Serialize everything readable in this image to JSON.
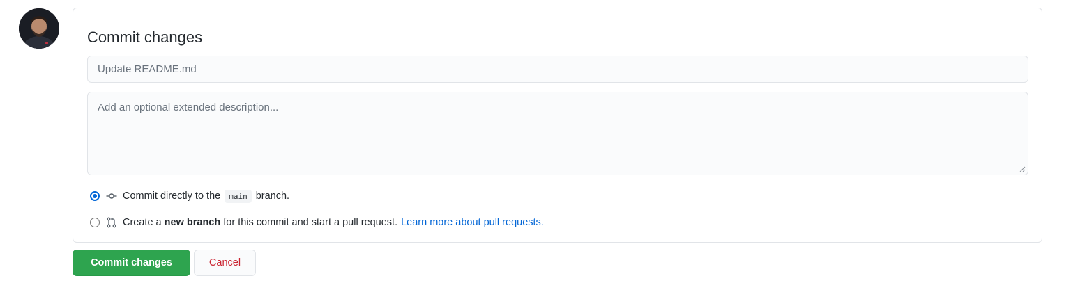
{
  "avatar": {
    "alt": "User avatar"
  },
  "commit_form": {
    "title": "Commit changes",
    "summary": {
      "placeholder": "Update README.md",
      "value": ""
    },
    "description": {
      "placeholder": "Add an optional extended description...",
      "value": ""
    },
    "options": {
      "direct": {
        "selected": true,
        "text_before": "Commit directly to the",
        "branch": "main",
        "text_after": "branch."
      },
      "new_branch": {
        "selected": false,
        "text_before": "Create a",
        "bold": "new branch",
        "text_after": "for this commit and start a pull request.",
        "link": "Learn more about pull requests."
      }
    }
  },
  "buttons": {
    "commit_label": "Commit changes",
    "cancel_label": "Cancel"
  },
  "colors": {
    "primary_green": "#2ea44f",
    "link_blue": "#0366d6",
    "cancel_red": "#cb2431",
    "border": "#e1e4e8"
  },
  "icons": {
    "direct_commit": "git-commit-icon",
    "new_branch": "git-pull-request-icon",
    "resize": "resize-grip-icon"
  }
}
